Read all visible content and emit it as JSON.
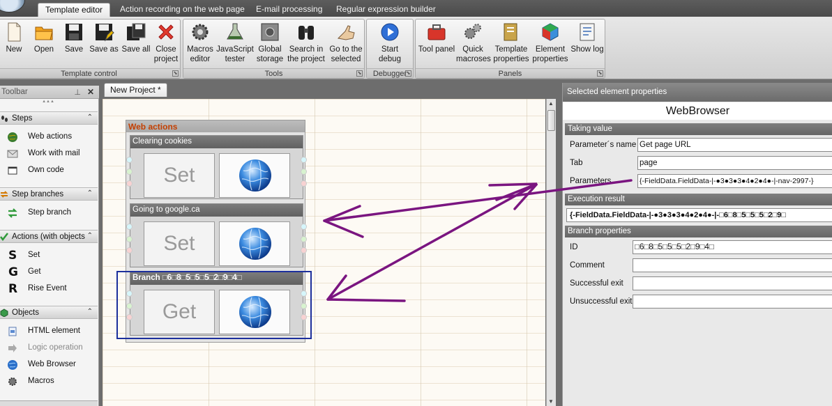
{
  "menu_tabs": [
    "Template editor",
    "Action recording on the web page",
    "E-mail processing",
    "Regular expression builder"
  ],
  "ribbon": {
    "template_control": {
      "label": "Template control",
      "buttons": [
        "New",
        "Open",
        "Save",
        "Save as",
        "Save all",
        "Close\nproject"
      ]
    },
    "tools": {
      "label": "Tools",
      "buttons": [
        "Macros\neditor",
        "JavaScript\ntester",
        "Global\nstorage",
        "Search in\nthe project",
        "Go to the\nselected"
      ]
    },
    "debugger": {
      "label": "Debugger",
      "buttons": [
        "Start\ndebug"
      ]
    },
    "panels": {
      "label": "Panels",
      "buttons": [
        "Tool panel",
        "Quick\nmacroses",
        "Template\nproperties",
        "Element\nproperties",
        "Show log"
      ]
    }
  },
  "toolbar": {
    "title": "Toolbar",
    "sections": [
      {
        "title": "Steps",
        "items": [
          "Web actions",
          "Work with mail",
          "Own code"
        ]
      },
      {
        "title": "Step branches",
        "items": [
          "Step branch"
        ]
      },
      {
        "title": "Actions (with objects",
        "items": [
          "Set",
          "Get",
          "Rise Event"
        ],
        "letters": [
          "S",
          "G",
          "R"
        ]
      },
      {
        "title": "Objects",
        "items": [
          "HTML element",
          "Logic operation",
          "Web Browser",
          "Macros"
        ]
      }
    ]
  },
  "document": {
    "tab": "New Project *",
    "block_title": "Web actions",
    "actions": [
      {
        "title": "Clearing cookies",
        "op": "Set"
      },
      {
        "title": "Going to google.ca",
        "op": "Set"
      },
      {
        "title": "Branch □6□8□5□5□5□2□9□4□",
        "op": "Get"
      }
    ]
  },
  "properties": {
    "header": "Selected element properties",
    "object": "WebBrowser",
    "taking_value": {
      "title": "Taking value",
      "param_name_label": "Parameter´s name",
      "param_name_value": "Get page URL",
      "tab_label": "Tab",
      "tab_value": "page",
      "parameters_label": "Parameters",
      "parameters_value": "{-FieldData.FieldData-|-●3●3●3●4●2●4●-|-nav-2997-}"
    },
    "execution_result": {
      "title": "Execution result",
      "value": "{-FieldData.FieldData-|-●3●3●3●4●2●4●-|-□6□8□5□5□5□2□9□"
    },
    "branch": {
      "title": "Branch properties",
      "id_label": "ID",
      "id_value": "□6□8□5□5□5□2□9□4□",
      "comment_label": "Comment",
      "comment_value": "",
      "success_label": "Successful exit",
      "success_value": "",
      "fail_label": "Unsuccessful exit",
      "fail_value": ""
    }
  },
  "colors": {
    "annotation_arrow": "#7a1580",
    "block_title": "#c43f00",
    "selection_frame": "#1c2f9c"
  }
}
